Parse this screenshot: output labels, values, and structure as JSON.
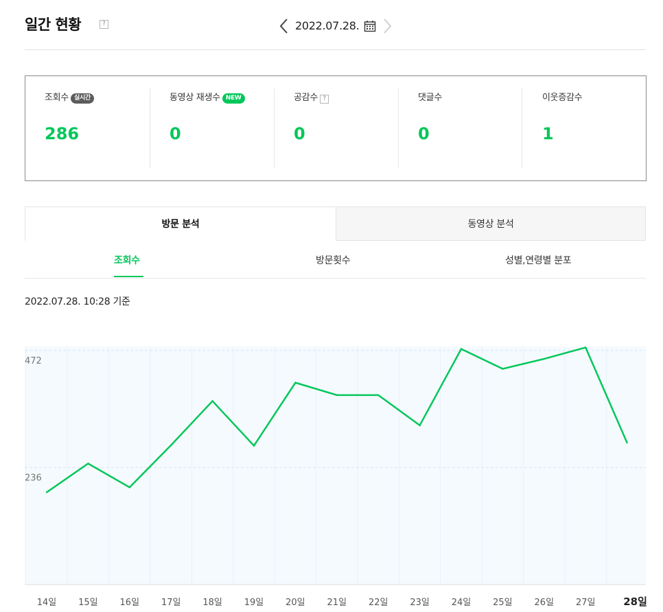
{
  "header": {
    "title": "일간 현황",
    "help_glyph": "?",
    "date": "2022.07.28.",
    "prev_icon": "chevron-left-icon",
    "next_icon": "chevron-right-icon",
    "calendar_icon": "calendar-icon"
  },
  "stats": [
    {
      "label": "조회수",
      "badge": "실시간",
      "value": "286"
    },
    {
      "label": "동영상 재생수",
      "badge": "NEW",
      "value": "0"
    },
    {
      "label": "공감수",
      "help": "?",
      "value": "0"
    },
    {
      "label": "댓글수",
      "value": "0"
    },
    {
      "label": "이웃증감수",
      "value": "1"
    }
  ],
  "main_tabs": [
    {
      "label": "방문 분석",
      "active": true
    },
    {
      "label": "동영상 분석",
      "active": false
    }
  ],
  "sub_tabs": [
    {
      "label": "조회수",
      "active": true
    },
    {
      "label": "방문횟수",
      "active": false
    },
    {
      "label": "성별,연령별 분포",
      "active": false
    }
  ],
  "as_of": "2022.07.28. 10:28 기준",
  "colors": {
    "accent": "#03c75a",
    "chart_bg": "#f5fafe",
    "badge_gray": "#5c5c5c"
  },
  "chart_data": {
    "type": "line",
    "categories": [
      "14일",
      "15일",
      "16일",
      "17일",
      "18일",
      "19일",
      "20일",
      "21일",
      "22일",
      "23일",
      "24일",
      "25일",
      "26일",
      "27일",
      "28일"
    ],
    "series": [
      {
        "values": [
          186,
          244,
          196,
          281,
          370,
          280,
          407,
          382,
          382,
          321,
          475,
          435,
          455,
          478,
          286
        ]
      }
    ],
    "y_ticks": [
      236,
      472
    ],
    "ylim": [
      0,
      480
    ],
    "highlight_category": "28일",
    "title": "",
    "xlabel": "",
    "ylabel": "",
    "grid": true
  }
}
